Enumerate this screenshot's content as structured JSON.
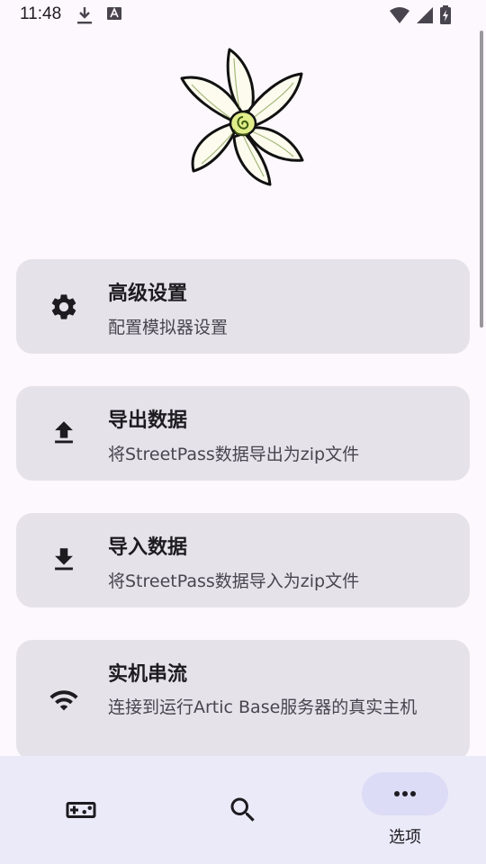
{
  "status_bar": {
    "time": "11:48",
    "icons": [
      "download-icon",
      "font-icon",
      "wifi-icon",
      "signal-icon",
      "battery-charging-icon"
    ]
  },
  "logo": {
    "icon": "flower-logo"
  },
  "menu": {
    "items": [
      {
        "icon": "gear-icon",
        "title": "高级设置",
        "description": "配置模拟器设置"
      },
      {
        "icon": "upload-icon",
        "title": "导出数据",
        "description": "将StreetPass数据导出为zip文件"
      },
      {
        "icon": "download-icon",
        "title": "导入数据",
        "description": "将StreetPass数据导入为zip文件"
      },
      {
        "icon": "wifi-icon",
        "title": "实机串流",
        "description": "连接到运行Artic Base服务器的真实主机"
      }
    ]
  },
  "bottom_nav": {
    "items": [
      {
        "icon": "gamepad-icon",
        "label": ""
      },
      {
        "icon": "search-icon",
        "label": ""
      },
      {
        "icon": "more-icon",
        "label": "选项",
        "selected": true
      }
    ]
  }
}
